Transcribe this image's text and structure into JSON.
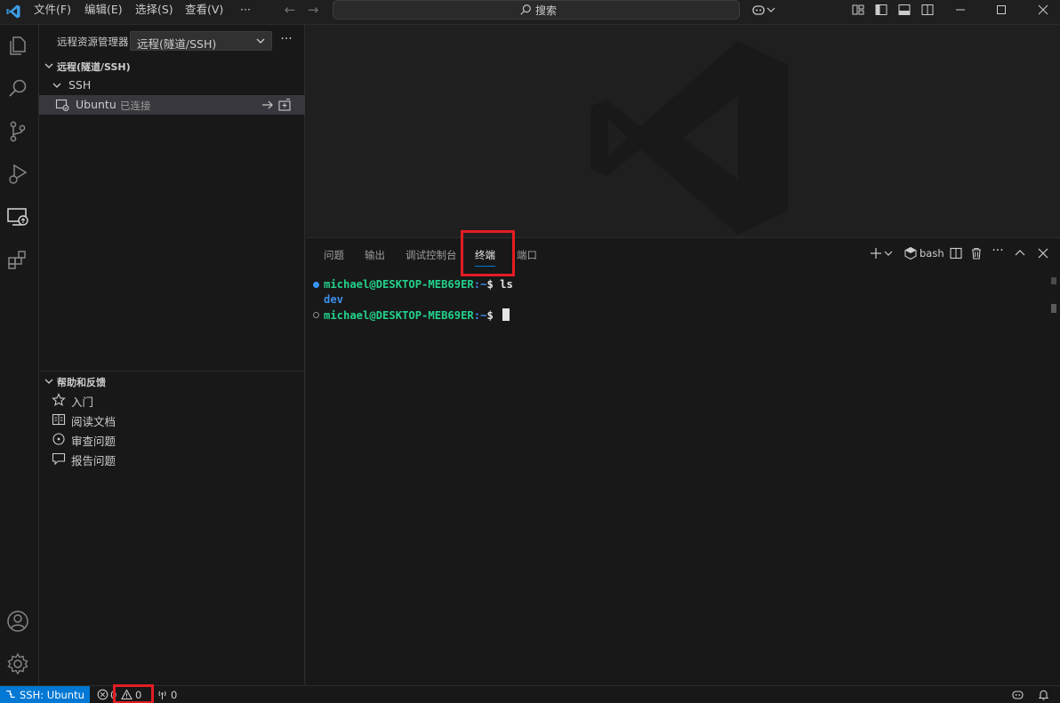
{
  "titlebar": {
    "menus": [
      "文件(F)",
      "编辑(E)",
      "选择(S)",
      "查看(V)",
      "···"
    ],
    "search_label": "搜索"
  },
  "sidebar": {
    "header": "远程资源管理器",
    "select_value": "远程(隧道/SSH)",
    "more": "···",
    "remote_section_title": "远程(隧道/SSH)",
    "ssh_group": "SSH",
    "host": {
      "name": "Ubuntu",
      "status": "已连接"
    },
    "help_section_title": "帮助和反馈",
    "help_items": [
      {
        "label": "入门",
        "icon": "star-icon"
      },
      {
        "label": "阅读文档",
        "icon": "book-icon"
      },
      {
        "label": "审查问题",
        "icon": "issues-icon"
      },
      {
        "label": "报告问题",
        "icon": "comment-icon"
      }
    ]
  },
  "panel": {
    "tabs": [
      "问题",
      "输出",
      "调试控制台",
      "终端",
      "端口"
    ],
    "active_tab": "终端",
    "shell": "bash"
  },
  "terminal": {
    "lines": [
      {
        "user": "michael@DESKTOP-MEB69ER",
        "path": ":~",
        "prompt": "$ ",
        "command": "ls"
      },
      {
        "output": "dev"
      },
      {
        "user": "michael@DESKTOP-MEB69ER",
        "path": ":~",
        "prompt": "$ ",
        "command": ""
      }
    ]
  },
  "statusbar": {
    "remote": "SSH: Ubuntu",
    "errors": "0",
    "warnings": "0",
    "ports": "0"
  },
  "colors": {
    "accent": "#0078d4",
    "highlight": "#e51c23",
    "terminal_user": "#23d18b",
    "terminal_path": "#3b8eea"
  }
}
